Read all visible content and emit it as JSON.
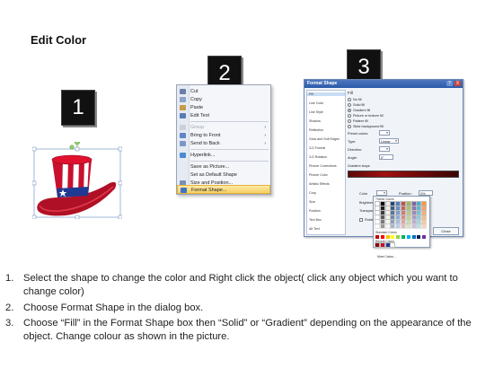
{
  "title": "Edit Color",
  "badges": [
    "1",
    "2",
    "3"
  ],
  "context_menu": {
    "items": [
      {
        "label": "Cut",
        "icon": "scissors-icon",
        "state": "normal"
      },
      {
        "label": "Copy",
        "icon": "copy-icon",
        "state": "normal"
      },
      {
        "label": "Paste",
        "icon": "paste-icon",
        "state": "normal"
      },
      {
        "label": "Edit Text",
        "icon": "text-icon",
        "state": "normal"
      },
      {
        "label": "Group",
        "icon": "group-icon",
        "state": "disabled",
        "arrow": "›"
      },
      {
        "label": "Bring to Front",
        "icon": "front-icon",
        "state": "normal",
        "arrow": "›"
      },
      {
        "label": "Send to Back",
        "icon": "back-icon",
        "state": "normal",
        "arrow": "›"
      },
      {
        "label": "Hyperlink...",
        "icon": "link-icon",
        "state": "normal"
      },
      {
        "label": "Save as Picture...",
        "icon": "",
        "state": "normal"
      },
      {
        "label": "Set as Default Shape",
        "icon": "",
        "state": "normal"
      },
      {
        "label": "Size and Position...",
        "icon": "size-icon",
        "state": "normal"
      },
      {
        "label": "Format Shape...",
        "icon": "format-icon",
        "state": "highlighted"
      }
    ]
  },
  "dialog": {
    "title": "Format Shape",
    "help": "?",
    "close": "X",
    "nav": [
      "Fill",
      "Line Color",
      "Line Style",
      "Shadow",
      "Reflection",
      "Glow and Soft Edges",
      "3-D Format",
      "3-D Rotation",
      "Picture Corrections",
      "Picture Color",
      "Artistic Effects",
      "Crop",
      "Size",
      "Position",
      "Text Box",
      "Alt Text"
    ],
    "section_title": "Fill",
    "fill_options": [
      "No fill",
      "Solid fill",
      "Gradient fill",
      "Picture or texture fill",
      "Pattern fill",
      "Slide background fill"
    ],
    "selected_fill": "Gradient fill",
    "preset_colors_label": "Preset colors:",
    "type_label": "Type:",
    "type_value": "Linear",
    "direction_label": "Direction:",
    "angle_label": "Angle:",
    "angle_value": "0°",
    "gradient_stops_label": "Gradient stops",
    "color_label": "Color",
    "position_label": "Position:",
    "position_value": "0%",
    "brightness_label": "Brightness",
    "transparency_label": "Transparency",
    "rotate_label": "Rotate with shape",
    "close_button": "Close",
    "palette": {
      "theme_colors": "Theme Colors",
      "standard_colors": "Standard Colors",
      "recent_colors": "Recent Colors",
      "more_colors": "More Colors..."
    }
  },
  "steps": [
    {
      "num": "1.",
      "text": "Select the shape to change the color and Right click the object( click any object which you want to change color)"
    },
    {
      "num": "2.",
      "text": "Choose Format Shape in the dialog box."
    },
    {
      "num": "3.",
      "text": "Choose “Fill” in the Format Shape box then “Solid” or “Gradient” depending on the appearance of the object. Change colour as shown in the picture."
    }
  ],
  "colors": {
    "hat_red": "#c8102e",
    "hat_blue": "#1f3a93",
    "highlight": "#f6cf62",
    "gradient_dark_red": "#8b0a0a"
  }
}
